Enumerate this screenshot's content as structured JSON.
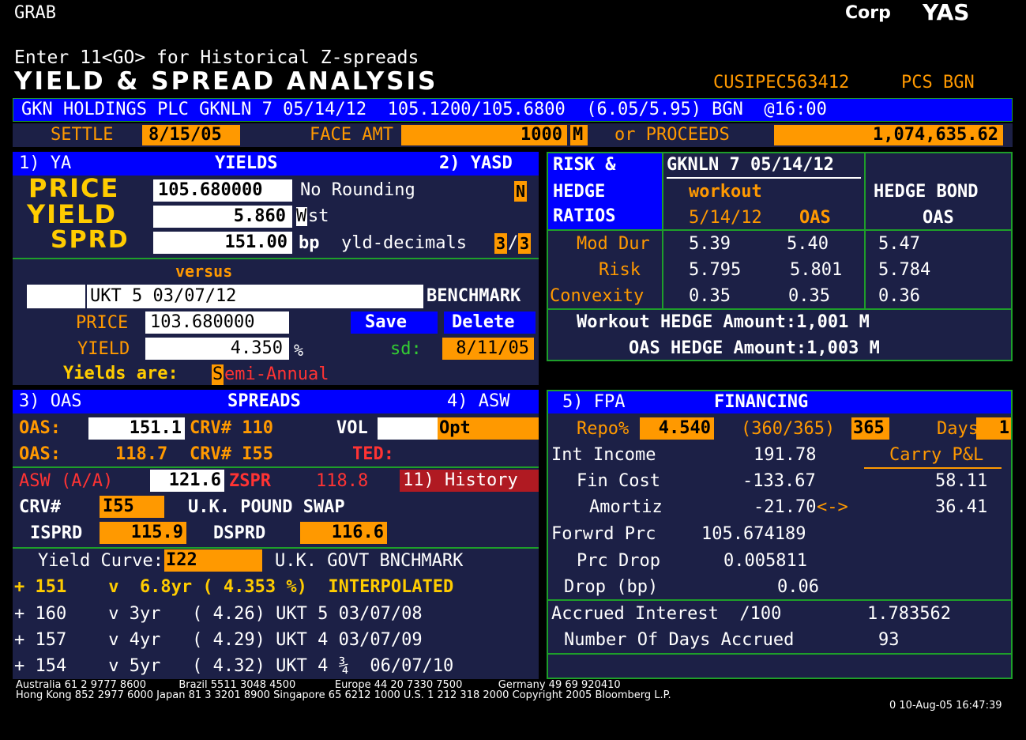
{
  "header": {
    "grab": "GRAB",
    "corp": "Corp",
    "yas": "YAS",
    "hint": "Enter 11<GO> for Historical Z-spreads",
    "title": "YIELD & SPREAD ANALYSIS",
    "cusip": "CUSIPEC563412",
    "pcs": "PCS BGN"
  },
  "bond_bar": "GKN HOLDINGS PLC GKNLN 7 05/14/12  105.1200/105.6800  (6.05/5.95) BGN  @16:00",
  "settle_row": {
    "settle_label": "SETTLE",
    "settle_date": "8/15/05",
    "face_label": "FACE AMT",
    "face_amt": "1000",
    "m": "M",
    "or_proceeds": "or PROCEEDS",
    "proceeds": "1,074,635.62"
  },
  "yields": {
    "tab1": "1) YA",
    "title": "YIELDS",
    "tab2": "2) YASD",
    "price_label": "PRICE",
    "price": "105.680000",
    "no_rounding": "No Rounding",
    "n_flag": "N",
    "yield_label": "YIELD",
    "yield": "5.860",
    "wst_w": "W",
    "wst_rest": "st",
    "sprd_label": "SPRD",
    "sprd": "151.00",
    "bp": "bp",
    "yld_decimals": "yld-decimals",
    "dec1": "3",
    "slash": "/",
    "dec2": "3",
    "versus": "versus",
    "benchmark_ticker": "UKT 5 03/07/12",
    "benchmark_label": "BENCHMARK",
    "b_price_label": "PRICE",
    "b_price": "103.680000",
    "save": "Save",
    "delete": "Delete",
    "b_yield_label": "YIELD",
    "b_yield": "4.350",
    "pct": "%",
    "sd_label": "sd:",
    "sd": "8/11/05",
    "yields_are": "Yields are:",
    "semi_s": "S",
    "semi_rest": "emi-Annual"
  },
  "risk": {
    "title1": "RISK &",
    "title2": "HEDGE",
    "title3": "RATIOS",
    "bond": "GKNLN 7 05/14/12",
    "workout": "workout",
    "wk_date": "5/14/12",
    "wk_oas": "OAS",
    "hedge_bond": "HEDGE BOND",
    "hedge_oas": "OAS",
    "rows": [
      {
        "label": "Mod Dur",
        "v1": "5.39",
        "v2": "5.40",
        "v3": "5.47"
      },
      {
        "label": "Risk",
        "v1": "5.795",
        "v2": "5.801",
        "v3": "5.784"
      },
      {
        "label": "Convexity",
        "v1": "0.35",
        "v2": "0.35",
        "v3": "0.36"
      }
    ],
    "workout_hedge": "Workout HEDGE Amount:1,001 M",
    "oas_hedge": "OAS HEDGE Amount:1,003 M"
  },
  "spreads": {
    "tab3": "3) OAS",
    "title": "SPREADS",
    "tab4": "4) ASW",
    "oas1_label": "OAS:",
    "oas1": "151.1",
    "crv1": "CRV# 110",
    "vol": "VOL",
    "opt": "Opt",
    "oas2_label": "OAS:",
    "oas2": "118.7",
    "crv2": "CRV# I55",
    "ted": "TED:",
    "asw_label": "ASW (A/A)",
    "asw": "121.6",
    "zspr_label": "ZSPR",
    "zspr": "118.8",
    "history": "11) History",
    "crv_label": "CRV#",
    "crv": "I55",
    "crv_name": "U.K. POUND SWAP",
    "isprd_label": "ISPRD",
    "isprd": "115.9",
    "dsprd_label": "DSPRD",
    "dsprd": "116.6",
    "yc_label": "Yield Curve:",
    "yc": "I22",
    "yc_name": "U.K. GOVT BNCHMARK",
    "curve_rows": [
      "+ 151    v  6.8yr ( 4.353 %)  INTERPOLATED",
      "+ 160    v 3yr   ( 4.26) UKT 5 03/07/08",
      "+ 157    v 4yr   ( 4.29) UKT 4 03/07/09",
      "+ 154    v 5yr   ( 4.32) UKT 4 ¾  06/07/10"
    ]
  },
  "financing": {
    "tab5": "5) FPA",
    "title": "FINANCING",
    "repo_label": "Repo%",
    "repo": "4.540",
    "basis": "(360/365)",
    "basis_val": "365",
    "days_label": "Days",
    "days": "1",
    "int_income_label": "Int Income",
    "int_income": "191.78",
    "carry_label": "Carry P&L",
    "fin_cost_label": "Fin Cost",
    "fin_cost": "-133.67",
    "carry1": "58.11",
    "amortiz_label": "Amortiz",
    "amortiz": "-21.70",
    "arrows": "<->",
    "carry2": "36.41",
    "fwd_label": "Forwrd Prc",
    "fwd": "105.674189",
    "drop_label": "Prc Drop",
    "drop": "0.005811",
    "dropbp_label": "Drop (bp)",
    "dropbp": "0.06",
    "accrued_label": "Accrued Interest  /100",
    "accrued": "1.783562",
    "days_acc_label": "Number Of Days Accrued",
    "days_acc": "93"
  },
  "footer": {
    "line1": "Australia 61 2 9777 8600          Brazil 5511 3048 4500            Europe 44 20 7330 7500           Germany 49 69 920410",
    "line2": "Hong Kong 852 2977 6000 Japan 81 3 3201 8900 Singapore 65 6212 1000 U.S. 1 212 318 2000 Copyright 2005 Bloomberg L.P.",
    "line3": "0 10-Aug-05 16:47:39"
  }
}
